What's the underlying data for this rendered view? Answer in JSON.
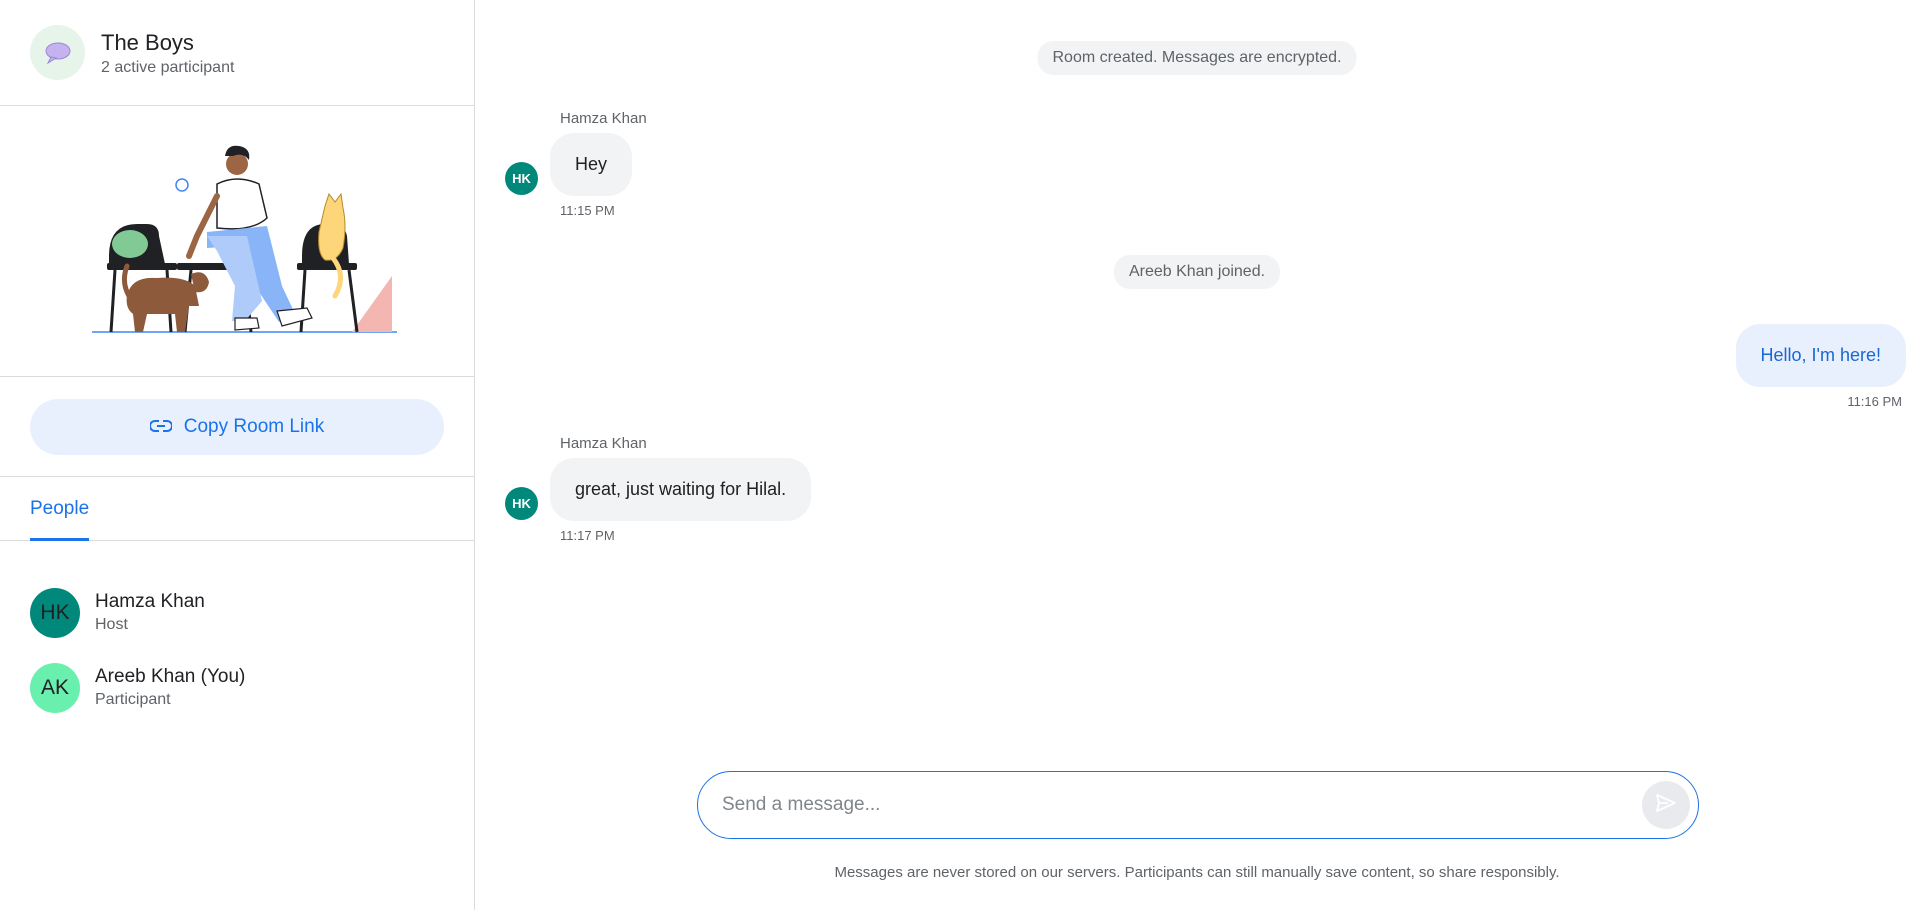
{
  "room": {
    "title": "The Boys",
    "subtitle": "2 active participant",
    "icon": "speech-bubble-icon"
  },
  "actions": {
    "copy_link_label": "Copy Room Link",
    "copy_link_icon": "link-icon"
  },
  "tabs": [
    {
      "label": "People",
      "active": true
    }
  ],
  "people": [
    {
      "initials": "HK",
      "name": "Hamza Khan",
      "role": "Host",
      "avatar_color": "#00897b"
    },
    {
      "initials": "AK",
      "name": "Areeb Khan (You)",
      "role": "Participant",
      "avatar_color": "#69f0ae"
    }
  ],
  "messages": {
    "system_created": "Room created. Messages are encrypted.",
    "msg1": {
      "sender": "Hamza Khan",
      "initials": "HK",
      "text": "Hey",
      "time": "11:15 PM"
    },
    "system_joined": "Areeb Khan joined.",
    "msg2": {
      "text": "Hello, I'm here!",
      "time": "11:16 PM"
    },
    "msg3": {
      "sender": "Hamza Khan",
      "initials": "HK",
      "text": "great, just waiting for Hilal.",
      "time": "11:17 PM"
    }
  },
  "composer": {
    "placeholder": "Send a message...",
    "value": "",
    "send_icon": "send-icon"
  },
  "footer": {
    "disclaimer": "Messages are never stored on our servers. Participants can still manually save content, so share responsibly."
  },
  "colors": {
    "accent": "#1a73e8",
    "host_avatar": "#00897b",
    "participant_avatar": "#69f0ae",
    "outgoing_bubble": "#e8f0fe",
    "incoming_bubble": "#f1f3f4"
  }
}
